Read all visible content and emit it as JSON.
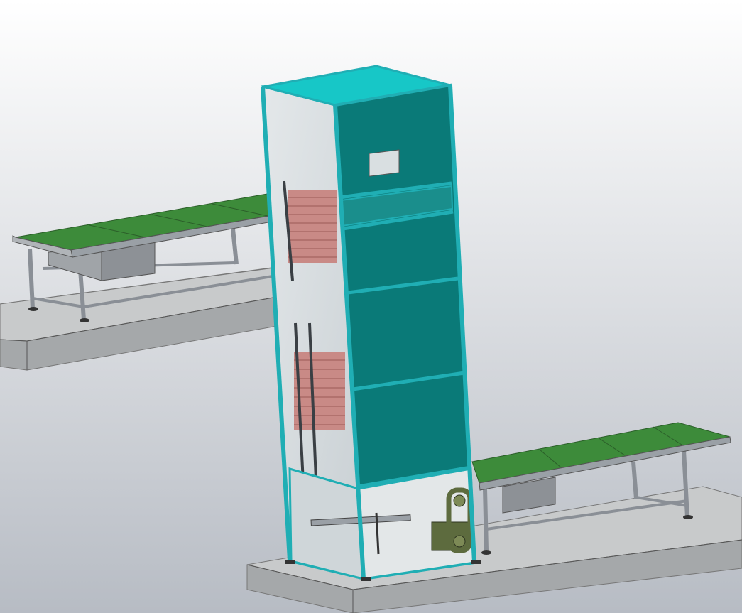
{
  "view": {
    "background_top": "#ffffff",
    "background_bottom": "#b7bcc4"
  },
  "colors": {
    "cabinet_panel": "#0a7a78",
    "cabinet_frame": "#20aeb4",
    "cabinet_top": "#17c7c7",
    "glass": "#d7dde0",
    "belt": "#3d8b3a",
    "steel": "#8a8f96",
    "platform_top": "#c8cacb",
    "platform_side": "#a5a8aa",
    "slats": "#c98a86",
    "motor_guard": "#5d6b3e"
  },
  "model": {
    "parts": [
      "elevator-tower",
      "upper-infeed-conveyor",
      "lower-outfeed-conveyor",
      "upper-platform",
      "lower-platform",
      "drive-motor"
    ]
  }
}
